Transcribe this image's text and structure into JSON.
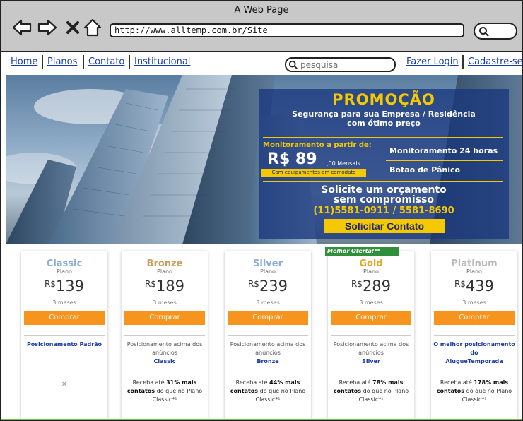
{
  "window": {
    "title": "A Web Page",
    "url": "http://www.alltemp.com.br/Site"
  },
  "nav": {
    "links": [
      "Home",
      "Planos",
      "Contato",
      "Institucional"
    ],
    "search_placeholder": "pesquisa",
    "login": "Fazer Login",
    "signup": "Cadastre-se"
  },
  "hero": {
    "title": "PROMOÇÃO",
    "subtitle_1": "Segurança para sua Empresa / Residência",
    "subtitle_2": "com ótimo preço",
    "monitor_label": "Monitoramento a partir de:",
    "price_main": "R$ 89",
    "price_cents": ",00 Mensais",
    "equipment_note": "Com equipamentos em comodato",
    "feature_1": "Monitoramento 24 horas",
    "feature_2": "Botão de Pânico",
    "cta_1": "Solicite um orçamento",
    "cta_2": "sem compromisso",
    "phone": "(11)5581-0911 / 5581-8690",
    "button": "Solicitar Contato"
  },
  "plans": [
    {
      "name": "Classic",
      "label": "Plano",
      "currency": "R$",
      "price": "139",
      "period": "3 meses",
      "button": "Comprar",
      "desc": "Posicionamento Padrão",
      "color": "#8aaed8"
    },
    {
      "name": "Bronze",
      "label": "Plano",
      "currency": "R$",
      "price": "189",
      "period": "3 meses",
      "button": "Comprar",
      "desc_pre": "Posicionamento acima dos anúncios",
      "desc_bold": "Classic",
      "extra_pre": "Receba até",
      "extra_bold": "31% mais contatos",
      "extra_post": "do que no Plano Classic*¹",
      "color": "#c8a05a"
    },
    {
      "name": "Silver",
      "label": "Plano",
      "currency": "R$",
      "price": "239",
      "period": "3 meses",
      "button": "Comprar",
      "desc_pre": "Posicionamento acima dos anúncios",
      "desc_bold": "Bronze",
      "extra_pre": "Receba até",
      "extra_bold": "44% mais contatos",
      "extra_post": "do que no Plano Classic*¹",
      "color": "#8aaed8"
    },
    {
      "name": "Gold",
      "label": "Plano",
      "currency": "R$",
      "price": "289",
      "period": "3 meses",
      "button": "Comprar",
      "desc_pre": "Posicionamento acima dos anúncios",
      "desc_bold": "Silver",
      "extra_pre": "Receba até",
      "extra_bold": "78% mais contatos",
      "extra_post": "do que no Plano Classic*¹",
      "ribbon": "Melhor Oferta!**",
      "color": "#e0a82a"
    },
    {
      "name": "Platinum",
      "label": "Plano",
      "currency": "R$",
      "price": "439",
      "period": "3 meses",
      "button": "Comprar",
      "desc_pre": "O melhor posicionamento do",
      "desc_bold": "AlugueTemporada",
      "extra_pre": "Receba até",
      "extra_bold": "178% mais contatos",
      "extra_post": "do que no Plano Classic*¹",
      "color": "#bbbbbb"
    }
  ]
}
